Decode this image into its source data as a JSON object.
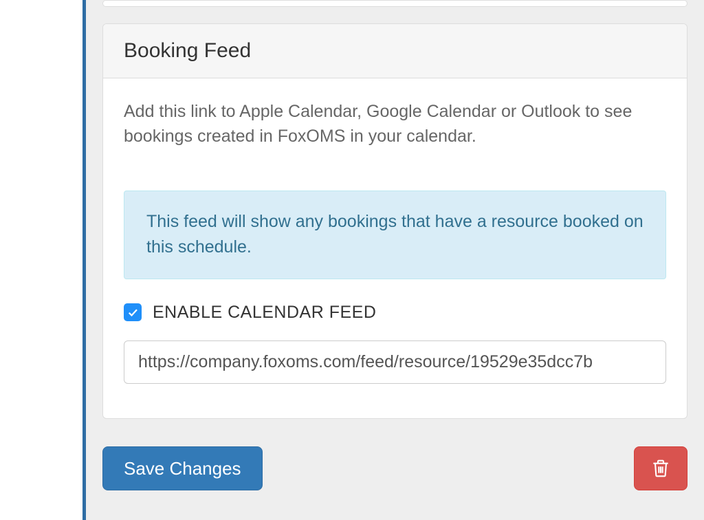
{
  "panel": {
    "title": "Booking Feed",
    "description": "Add this link to Apple Calendar, Google Calendar or Outlook to see bookings created in FoxOMS in your calendar.",
    "info_alert": "This feed will show any bookings that have a resource booked on this schedule.",
    "enable_checkbox": {
      "checked": true,
      "label": "ENABLE CALENDAR FEED"
    },
    "feed_url": "https://company.foxoms.com/feed/resource/19529e35dcc7b"
  },
  "actions": {
    "save_label": "Save Changes"
  },
  "colors": {
    "primary": "#337ab7",
    "danger": "#d9534f",
    "info_bg": "#d9edf7",
    "info_text": "#31708f",
    "checkbox": "#1f8ff9"
  }
}
